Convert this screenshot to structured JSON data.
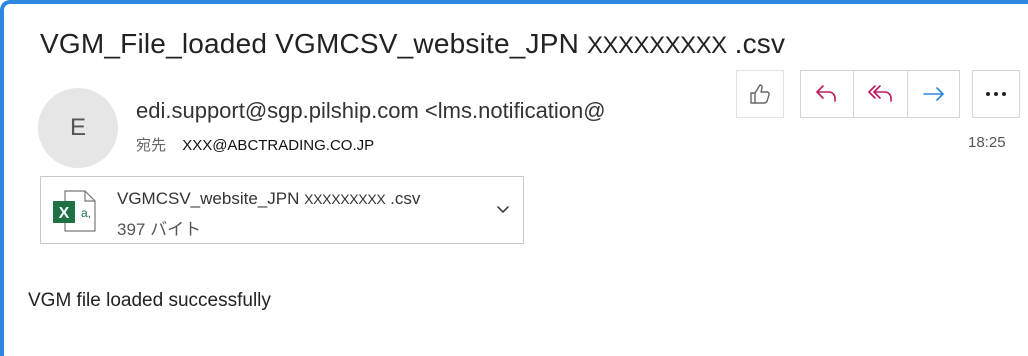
{
  "subject": {
    "prefix": "VGM_File_loaded VGMCSV_website_JPN",
    "masked": "XXXXXXXXX",
    "suffix": " .csv"
  },
  "sender": {
    "avatar_initial": "E",
    "display": "edi.support@sgp.pilship.com <lms.notification@",
    "to_label": "宛先",
    "to_value": "XXX@ABCTRADING.CO.JP",
    "time": "18:25"
  },
  "toolbar": {
    "icons": [
      "thumbs-up-icon",
      "reply-icon",
      "reply-all-icon",
      "forward-icon",
      "more-icon"
    ],
    "reply_color": "#c2185b",
    "forward_color": "#2e86e0"
  },
  "attachment": {
    "name_prefix": "VGMCSV_website_JPN",
    "name_masked": "XXXXXXXXX",
    "name_suffix": " .csv",
    "size": "397 バイト",
    "icon": "excel-file-icon"
  },
  "body": {
    "text": "VGM file loaded successfully"
  },
  "colors": {
    "accent_border": "#2e86e0",
    "excel_green": "#1e7145"
  }
}
